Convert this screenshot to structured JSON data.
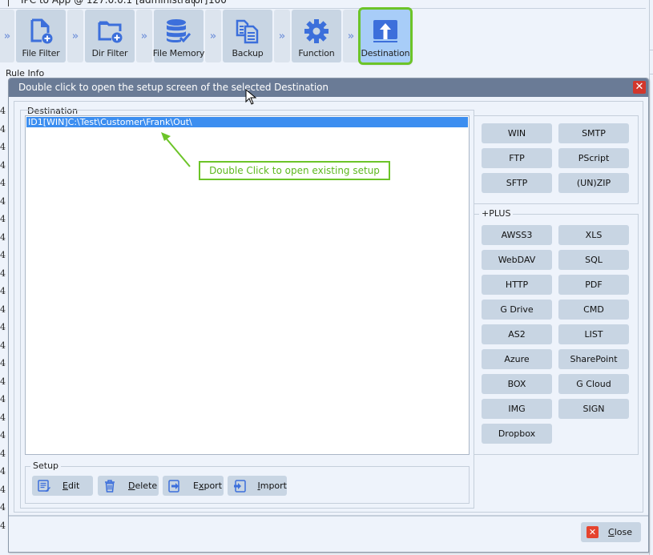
{
  "top_strip": {
    "text": "IPC to App @ 127.0.0.1 [administrator]",
    "value": "100"
  },
  "pipeline": {
    "steps": [
      {
        "label": "File Filter",
        "icon": "file-add-icon"
      },
      {
        "label": "Dir Filter",
        "icon": "folder-add-icon"
      },
      {
        "label": "File Memory",
        "icon": "database-check-icon"
      },
      {
        "label": "Backup",
        "icon": "copy-document-icon"
      },
      {
        "label": "Function",
        "icon": "gear-icon"
      },
      {
        "label": "Destination",
        "icon": "upload-icon",
        "active": true
      }
    ]
  },
  "rule_info_label": "Rule Info",
  "left_column_values": [
    "4",
    "4",
    "4",
    "4",
    "4",
    "4",
    "4",
    "4",
    "4",
    "4",
    "4",
    "4",
    "4",
    "4",
    "4",
    "4",
    "4",
    "4",
    "4",
    "4",
    "4",
    "4",
    "4",
    "4"
  ],
  "dialog": {
    "title": "Double click to open the setup screen of the selected Destination",
    "close_glyph": "✕",
    "destination_group_label": "Destination",
    "destinations": [
      "ID1[WIN]C:\\Test\\Customer\\Frank\\Out\\"
    ],
    "callout_text": "Double Click to open existing setup",
    "basic_types": [
      "WIN",
      "SMTP",
      "FTP",
      "PScript",
      "SFTP",
      "(UN)ZIP"
    ],
    "plus_group_label": "+PLUS",
    "plus_types": [
      "AWSS3",
      "XLS",
      "WebDAV",
      "SQL",
      "HTTP",
      "PDF",
      "G Drive",
      "CMD",
      "AS2",
      "LIST",
      "Azure",
      "SharePoint",
      "BOX",
      "G Cloud",
      "IMG",
      "SIGN",
      "Dropbox"
    ],
    "setup_group_label": "Setup",
    "setup_buttons": [
      {
        "mnemonic": "E",
        "rest": "dit",
        "icon": "edit-icon"
      },
      {
        "mnemonic": "D",
        "rest": "elete",
        "icon": "trash-icon"
      },
      {
        "pre": "E",
        "mnemonic": "x",
        "rest": "port",
        "icon": "export-icon"
      },
      {
        "mnemonic": "I",
        "rest": "mport",
        "icon": "import-icon"
      }
    ],
    "close_button": {
      "mnemonic": "C",
      "rest": "lose"
    }
  },
  "colors": {
    "accent_blue": "#3c6fdb",
    "selection_blue": "#3c8ef0",
    "highlight_green": "#6cc428",
    "title_bar": "#6a7b96",
    "close_red": "#d2372c"
  }
}
